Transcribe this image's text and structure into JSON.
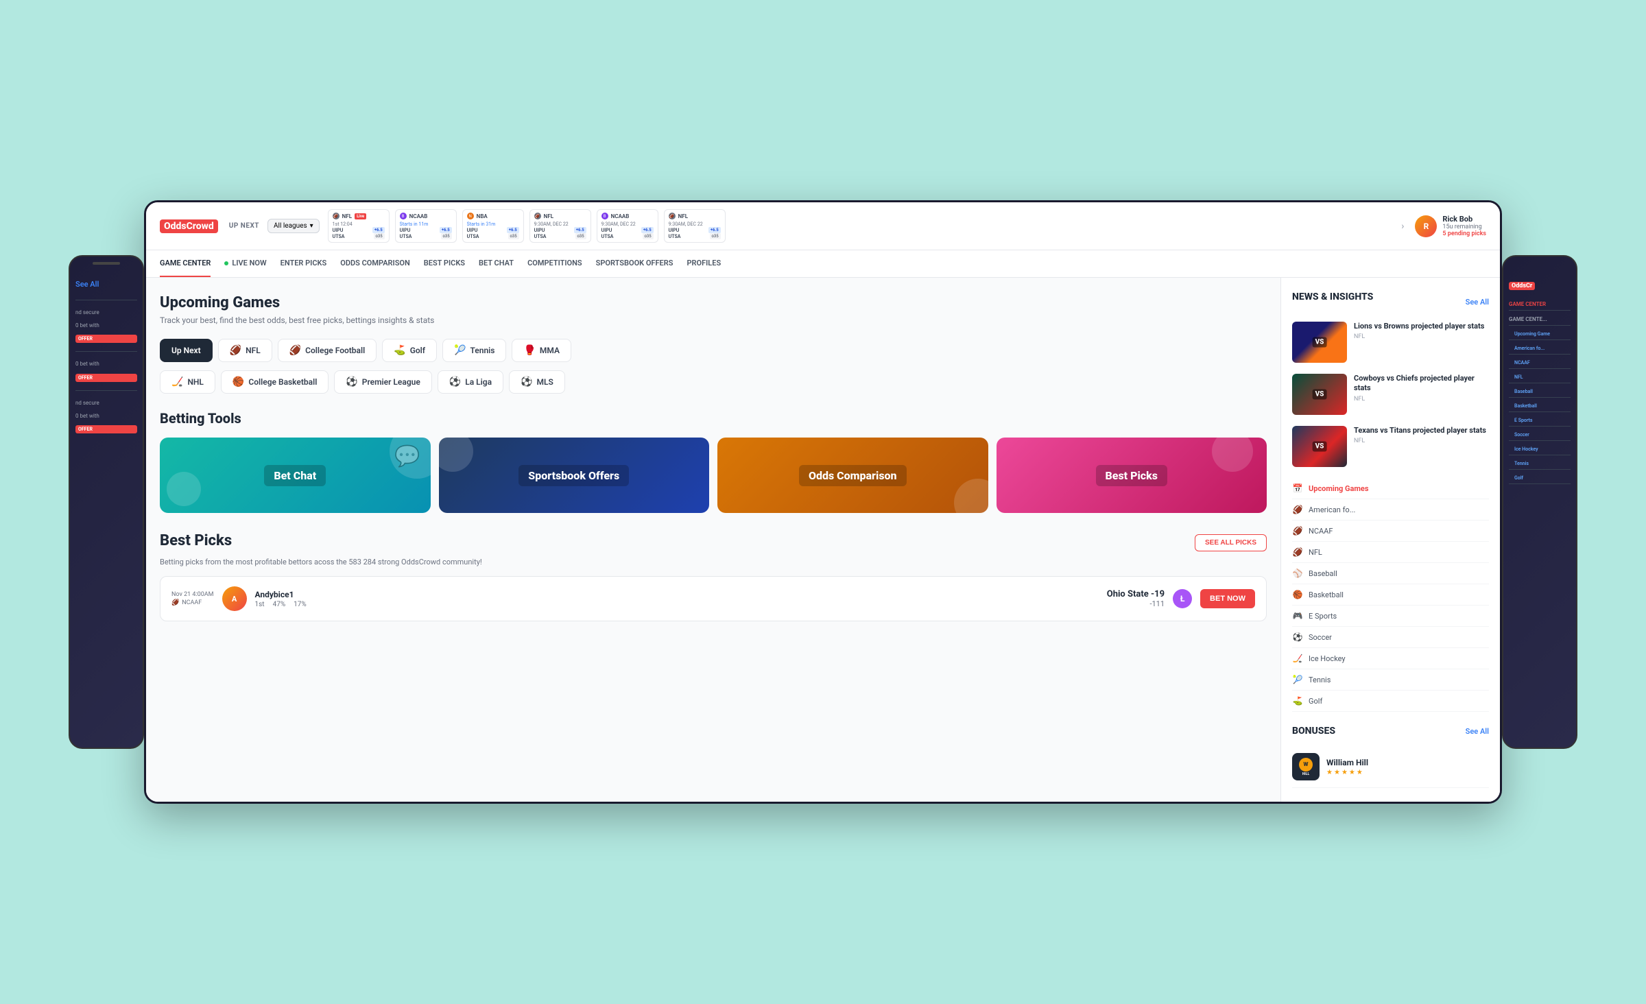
{
  "logo": {
    "odds": "Odds",
    "crowd": "Crowd"
  },
  "topBar": {
    "upNext": "UP NEXT",
    "allLeagues": "All leagues",
    "chevron": "▾",
    "games": [
      {
        "league": "NFL",
        "status": "Live",
        "time": "1st 12:04",
        "team1": "UIPU",
        "odds1": "+6.5",
        "team2": "UTSA",
        "total": "o35"
      },
      {
        "league": "NCAAB",
        "status": "starts",
        "time": "Starts in 11m",
        "team1": "UIPU",
        "odds1": "+6.5",
        "team2": "UTSA",
        "total": "o35"
      },
      {
        "league": "NBA",
        "status": "starts",
        "time": "Starts in 31m",
        "team1": "UIPU",
        "odds1": "+6.5",
        "team2": "UTSA",
        "total": "o35"
      },
      {
        "league": "NFL",
        "status": "scheduled",
        "time": "9:30AM, DEC 22",
        "team1": "UIPU",
        "odds1": "+6.5",
        "team2": "UTSA",
        "total": "o35"
      },
      {
        "league": "NCAAB",
        "status": "scheduled",
        "time": "9:30AM, DEC 22",
        "team1": "UIPU",
        "odds1": "+6.5",
        "team2": "UTSA",
        "total": "o35"
      },
      {
        "league": "NFL",
        "status": "scheduled",
        "time": "9:30AM, DEC 22",
        "team1": "UIPU",
        "odds1": "+6.5",
        "team2": "UTSA",
        "total": "o35"
      }
    ]
  },
  "user": {
    "name": "Rick Bob",
    "remaining": "15u remaining",
    "pendingPicks": "5 pending picks"
  },
  "nav": {
    "items": [
      {
        "label": "GAME CENTER",
        "active": true
      },
      {
        "label": "LIVE NOW",
        "live": true
      },
      {
        "label": "ENTER PICKS"
      },
      {
        "label": "ODDS COMPARISON"
      },
      {
        "label": "BEST PICKS"
      },
      {
        "label": "BET CHAT"
      },
      {
        "label": "COMPETITIONS"
      },
      {
        "label": "SPORTSBOOK OFFERS"
      },
      {
        "label": "PROFILES"
      }
    ]
  },
  "upcomingGames": {
    "title": "Upcoming Games",
    "subtitle": "Track your best, find the best odds, best free picks, bettings insights & stats",
    "sports": [
      {
        "label": "Up Next",
        "active": true,
        "icon": ""
      },
      {
        "label": "NFL",
        "icon": "🏈"
      },
      {
        "label": "College Football",
        "icon": "🏈"
      },
      {
        "label": "Golf",
        "icon": "⛳"
      },
      {
        "label": "Tennis",
        "icon": "🎾"
      },
      {
        "label": "MMA",
        "icon": "🥊"
      },
      {
        "label": "NHL",
        "icon": "🏒"
      },
      {
        "label": "College Basketball",
        "icon": "🏀"
      },
      {
        "label": "Premier League",
        "icon": "⚽"
      },
      {
        "label": "La Liga",
        "icon": "⚽"
      },
      {
        "label": "MLS",
        "icon": "⚽"
      }
    ]
  },
  "bettingTools": {
    "title": "Betting Tools",
    "tools": [
      {
        "label": "Bet Chat",
        "type": "bet-chat"
      },
      {
        "label": "Sportsbook Offers",
        "type": "sportsbook"
      },
      {
        "label": "Odds Comparison",
        "type": "odds"
      },
      {
        "label": "Best Picks",
        "type": "best-picks"
      }
    ]
  },
  "bestPicks": {
    "title": "Best Picks",
    "subtitle": "Betting picks from  the most profitable bettors acoss the 583 284 strong OddsCrowd community!",
    "seeAllLabel": "SEE ALL PICKS",
    "pick": {
      "date": "Nov 21 4:00AM",
      "league": "NCAAF",
      "username": "Andybice1",
      "rank": "1st",
      "winPercent": "47%",
      "roiPercent": "17%",
      "selection": "Ohio State -19",
      "odds": "-111",
      "betNow": "BET NOW"
    }
  },
  "newsInsights": {
    "title": "NEWS & INSIGHTS",
    "seeAll": "See All",
    "articles": [
      {
        "title": "Lions vs Browns projected player stats",
        "league": "NFL",
        "imgType": "lions"
      },
      {
        "title": "Cowboys vs Chiefs projected player stats",
        "league": "NFL",
        "imgType": "cowboys"
      },
      {
        "title": "Texans vs Titans projected player stats",
        "league": "NFL",
        "imgType": "texans"
      }
    ]
  },
  "gameCenterNav": {
    "items": [
      {
        "label": "Upcoming Games",
        "active": true,
        "icon": "📅"
      },
      {
        "label": "American fo...",
        "icon": "🏈"
      },
      {
        "label": "NCAAF",
        "icon": "🏈"
      },
      {
        "label": "NFL",
        "icon": "🏈"
      },
      {
        "label": "Baseball",
        "icon": "⚾"
      },
      {
        "label": "Basketball",
        "icon": "🏀"
      },
      {
        "label": "E Sports",
        "icon": "🎮"
      },
      {
        "label": "Soccer",
        "icon": "⚽"
      },
      {
        "label": "Ice Hockey",
        "icon": "🏒"
      },
      {
        "label": "Tennis",
        "icon": "🎾"
      },
      {
        "label": "Golf",
        "icon": "⛳"
      }
    ]
  },
  "bonuses": {
    "title": "BONUSES",
    "seeAll": "See All",
    "items": [
      {
        "name": "William Hill",
        "stars": 5,
        "logoText": "HILL"
      }
    ]
  },
  "leftPhone": {
    "seeAll": "See All",
    "items": [
      {
        "text": "nd secure"
      },
      {
        "text": "0 bet with",
        "type": "bet"
      },
      {
        "text": "OFFER",
        "type": "offer"
      },
      {
        "text": "0 bet with",
        "type": "bet"
      },
      {
        "text": "OFFER",
        "type": "offer"
      },
      {
        "text": "nd secure"
      },
      {
        "text": "0 bet with",
        "type": "bet"
      },
      {
        "text": "OFFER",
        "type": "offer"
      }
    ]
  },
  "rightPhone": {
    "logoOdds": "OddsCr",
    "navItems": [
      {
        "label": "GAME CENTER",
        "active": true
      },
      {
        "label": "GAME CENTE...",
        "sub": true
      },
      {
        "label": "Upcoming Game",
        "indent": true
      },
      {
        "label": "American fo...",
        "indent": true
      },
      {
        "label": "NCAAF",
        "indent": true
      },
      {
        "label": "NFL",
        "indent": true
      },
      {
        "label": "Baseball",
        "indent": true
      },
      {
        "label": "Basketball",
        "indent": true
      },
      {
        "label": "E Sports",
        "indent": true
      },
      {
        "label": "Soccer",
        "indent": true
      },
      {
        "label": "Ice Hockey",
        "indent": true
      },
      {
        "label": "Tennis",
        "indent": true
      },
      {
        "label": "Golf",
        "indent": true
      }
    ]
  }
}
